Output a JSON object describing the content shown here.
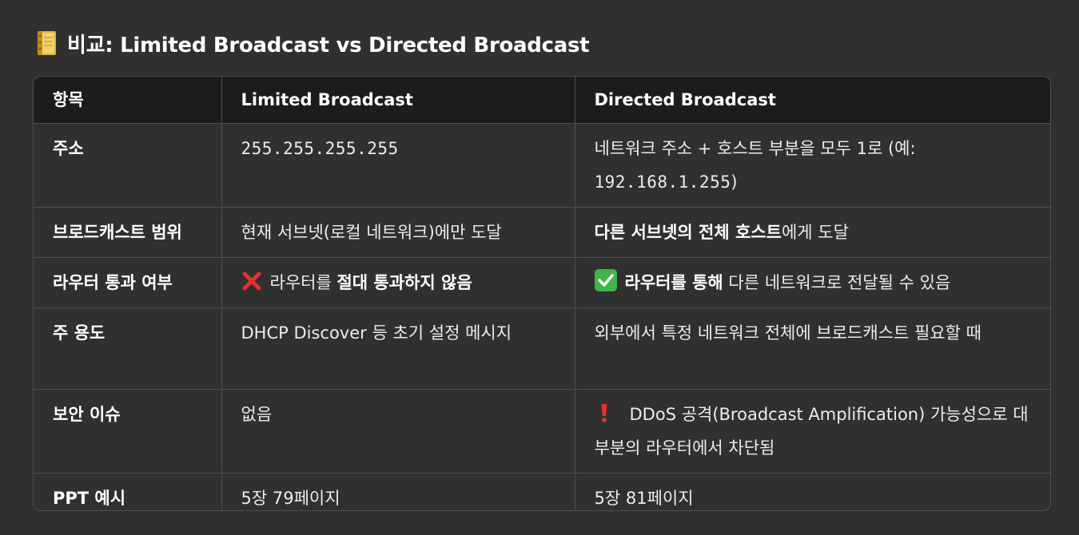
{
  "heading": {
    "icon": "ledger-book-icon",
    "text": "비교: Limited Broadcast vs Directed Broadcast"
  },
  "table": {
    "headers": [
      "항목",
      "Limited Broadcast",
      "Directed Broadcast"
    ],
    "rows": [
      {
        "label": "주소",
        "limited": "255.255.255.255",
        "directed_prefix": "네트워크 주소 + 호스트 부분을 모두 1로 (예:",
        "directed_code": "192.168.1.255",
        "directed_suffix": ")"
      },
      {
        "label": "브로드캐스트 범위",
        "limited": "현재 서브넷(로컬 네트워크)에만 도달",
        "directed_bold": "다른 서브넷의 전체 호스트",
        "directed_rest": "에게 도달"
      },
      {
        "label": "라우터 통과 여부",
        "limited_icon": "cross-mark-icon",
        "limited_prefix": "라우터를 ",
        "limited_bold": "절대 통과하지 않음",
        "directed_icon": "check-mark-icon",
        "directed_bold": "라우터를 통해",
        "directed_rest": " 다른 네트워크로 전달될 수 있음"
      },
      {
        "label": "주 용도",
        "limited": "DHCP Discover 등 초기 설정 메시지",
        "directed": "외부에서 특정 네트워크 전체에 브로드캐스트 필요할 때"
      },
      {
        "label": "보안 이슈",
        "limited": "없음",
        "directed_icon": "exclamation-icon",
        "directed": "DDoS 공격(Broadcast Amplification) 가능성으로 대부분의 라우터에서 차단됨"
      },
      {
        "label": "PPT 예시",
        "limited": "5장 79페이지",
        "directed": "5장 81페이지"
      }
    ]
  },
  "colors": {
    "background": "#303030",
    "header_bg": "#1c1c1c",
    "border": "#4f4f4f",
    "cross": "#e5322d",
    "check": "#41b34b",
    "exclamation": "#e5322d"
  }
}
